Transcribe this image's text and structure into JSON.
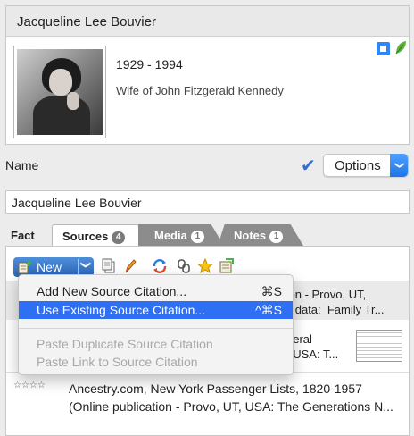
{
  "person": {
    "name": "Jacqueline Lee Bouvier",
    "lifespan": "1929 - 1994",
    "description": "Wife of John Fitzgerald Kennedy"
  },
  "name_row": {
    "label": "Name",
    "check_icon": "✔",
    "options_label": "Options",
    "options_arrow": "❯",
    "value": "Jacqueline Lee Bouvier"
  },
  "tabs": {
    "fact": "Fact",
    "sources": {
      "label": "Sources",
      "count": "4"
    },
    "media": {
      "label": "Media",
      "count": "1"
    },
    "notes": {
      "label": "Notes",
      "count": "1"
    }
  },
  "toolbar": {
    "new_label": "New",
    "new_arrow": "❯",
    "icons": [
      "new-source-icon",
      "copy-icon",
      "edit-pencil-icon",
      "sync-icon",
      "link-icon",
      "star-icon",
      "attach-icon"
    ]
  },
  "menu": {
    "items": [
      {
        "label": "Add New Source Citation...",
        "shortcut": "⌘S",
        "state": "normal"
      },
      {
        "label": "Use Existing Source Citation...",
        "shortcut": "^⌘S",
        "state": "selected"
      },
      {
        "label": "Paste Duplicate Source Citation",
        "shortcut": "",
        "state": "disabled"
      },
      {
        "label": "Paste Link to Source Citation",
        "shortcut": "",
        "state": "disabled"
      }
    ]
  },
  "sources": {
    "rows": [
      {
        "text": "tion - Provo, UT,\nal data:  Family Tr..."
      },
      {
        "text": "deral\n, USA: T..."
      },
      {
        "stars": "☆☆☆☆",
        "text_line1": "Ancestry.com, New York Passenger Lists, 1820-1957",
        "text_line2": "(Online publication - Provo, UT, USA: The Generations N..."
      }
    ]
  },
  "colors": {
    "accent": "#2f6ff3",
    "check": "#2f6fd6",
    "leaf": "#5cb338"
  }
}
